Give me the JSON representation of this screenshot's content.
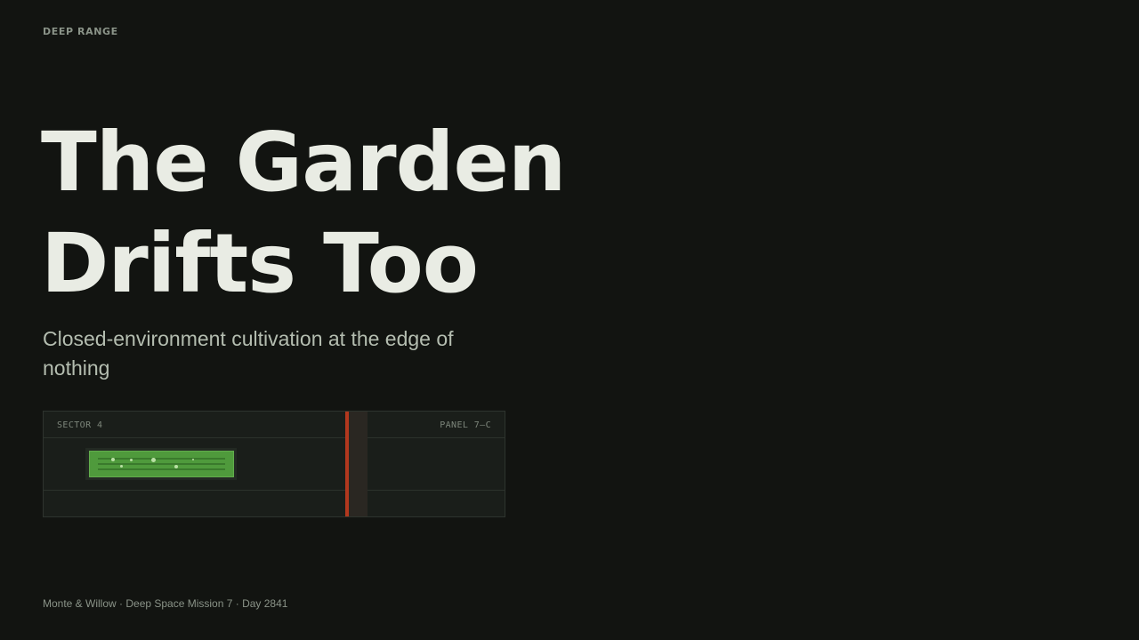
{
  "brand": "DEEP RANGE",
  "headline": {
    "line1": "The Garden",
    "line2": "Drifts Too"
  },
  "subtitle": "Closed-environment cultivation at the edge of nothing",
  "panel": {
    "sector_label": "SECTOR 4",
    "panel_label": "PANEL 7–C"
  },
  "footer": "Monte & Willow · Deep Space Mission 7 · Day 2841",
  "colors": {
    "background": "#121411",
    "plant_tray": "#4f9a3c",
    "marker": "#b2381e"
  }
}
